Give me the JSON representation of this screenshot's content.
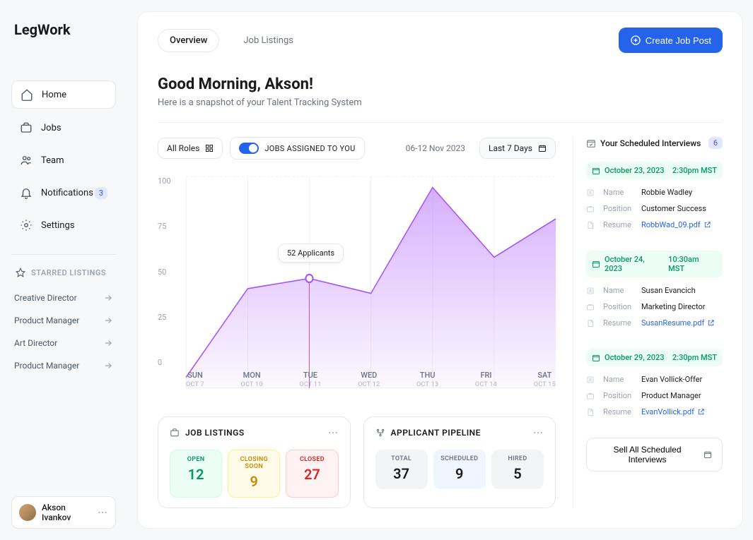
{
  "brand": "LegWork",
  "nav": {
    "items": [
      {
        "label": "Home",
        "active": true
      },
      {
        "label": "Jobs",
        "active": false
      },
      {
        "label": "Team",
        "active": false
      },
      {
        "label": "Notifications",
        "active": false,
        "badge": "3"
      },
      {
        "label": "Settings",
        "active": false
      }
    ],
    "starred_header": "STARRED LISTINGS",
    "starred": [
      {
        "label": "Creative Director"
      },
      {
        "label": "Product Manager"
      },
      {
        "label": "Art Director"
      },
      {
        "label": "Product Manager"
      }
    ]
  },
  "user": {
    "name": "Akson Ivankov"
  },
  "tabs": {
    "overview": "Overview",
    "listings": "Job Listings"
  },
  "create_label": "Create Job Post",
  "greeting": "Good Morning, Akson!",
  "subtitle": "Here is a snapshot of your Talent Tracking System",
  "controls": {
    "all_roles": "All Roles",
    "assigned": "JOBS ASSIGNED TO YOU",
    "date_range_text": "06-12 Nov 2023",
    "last7": "Last 7 Days"
  },
  "chart_data": {
    "type": "area",
    "categories": [
      "SUN",
      "MON",
      "TUE",
      "WED",
      "THU",
      "FRI",
      "SAT"
    ],
    "x_sub": [
      "OCT 7",
      "OCT 10",
      "OCT 11",
      "OCT 12",
      "OCT 13",
      "OCT 14",
      "OCT 15"
    ],
    "values": [
      5,
      47,
      52,
      45,
      95,
      62,
      80
    ],
    "ylim": [
      0,
      100
    ],
    "y_ticks": [
      "100",
      "75",
      "50",
      "25",
      "0"
    ],
    "tooltip": "52 Applicants",
    "title": "",
    "xlabel": "",
    "ylabel": ""
  },
  "job_listings": {
    "title": "JOB LISTINGS",
    "open": {
      "label": "OPEN",
      "value": "12"
    },
    "closing": {
      "label": "CLOSING SOON",
      "value": "9"
    },
    "closed": {
      "label": "CLOSED",
      "value": "27"
    }
  },
  "pipeline": {
    "title": "APPLICANT PIPELINE",
    "total": {
      "label": "TOTAL",
      "value": "37"
    },
    "scheduled": {
      "label": "SCHEDULED",
      "value": "9"
    },
    "hired": {
      "label": "HIRED",
      "value": "5"
    }
  },
  "interviews": {
    "title": "Your Scheduled Interviews",
    "count": "6",
    "labels": {
      "name": "Name",
      "position": "Position",
      "resume": "Resume"
    },
    "items": [
      {
        "date": "October 23, 2023",
        "time": "2:30pm MST",
        "name": "Robbie Wadley",
        "position": "Customer Success",
        "resume": "RobbWad_09.pdf"
      },
      {
        "date": "October 24, 2023",
        "time": "10:30am MST",
        "name": "Susan Evancich",
        "position": "Marketing Director",
        "resume": "SusanResume.pdf"
      },
      {
        "date": "October 29, 2023",
        "time": "2:30pm MST",
        "name": "Evan Vollick-Offer",
        "position": "Product Manager",
        "resume": "EvanVollick.pdf"
      }
    ],
    "sell_label": "Sell All Scheduled Interviews"
  }
}
